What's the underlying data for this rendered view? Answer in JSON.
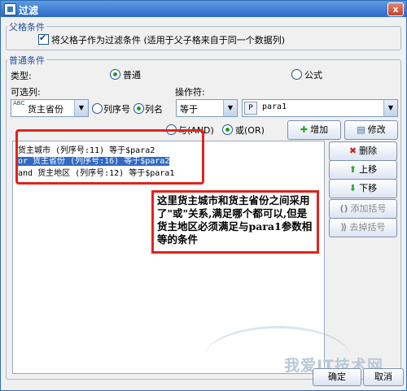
{
  "window": {
    "title": "过滤",
    "close_label": "x"
  },
  "parent_group": {
    "legend": "父格条件",
    "checkbox_label": "将父格子作为过滤条件 (适用于父子格来自于同一个数据列)",
    "checked": true
  },
  "normal_group": {
    "legend": "普通条件",
    "type_label": "类型:",
    "type_options": [
      "普通",
      "公式"
    ],
    "type_selected": "普通",
    "available_label": "可选列:",
    "column_value": "货主省份",
    "column_icon_text": "ABC",
    "mode_options": [
      "列序号",
      "列名"
    ],
    "mode_selected": "列名",
    "operator_label": "操作符:",
    "operator_value": "等于",
    "param_prefix": "P",
    "param_value": "para1",
    "logic_options": [
      "与(AND)",
      "或(OR)"
    ],
    "logic_selected": "或(OR)"
  },
  "buttons": {
    "add": "增加",
    "modify": "修改",
    "delete": "删除",
    "up": "上移",
    "down": "下移",
    "add_bracket": "添加括号",
    "remove_bracket": "去掉括号",
    "ok": "确定",
    "cancel": "取消"
  },
  "conditions": [
    {
      "text": "货主城市 (列序号:11) 等于$para2",
      "selected": false
    },
    {
      "text": "or  货主省份 (列序号:16) 等于$para2",
      "selected": true
    },
    {
      "text": "and 货主地区 (列序号:12) 等于$para1",
      "selected": false
    }
  ],
  "annotation": "这里货主城市和货主省份之间采用了\"或\"关系,满足哪个都可以,但是货主地区必须满足与para1参数相等的条件",
  "watermark": "我爱IT技术网",
  "colors": {
    "title_bar": "#2b6ac7",
    "highlight": "#e0241c",
    "selection": "#316ac5"
  }
}
